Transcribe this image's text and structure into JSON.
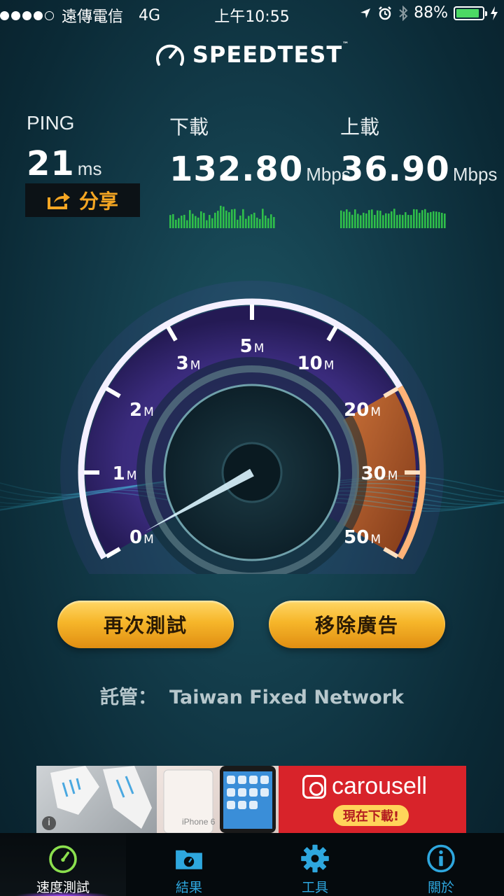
{
  "status_bar": {
    "carrier": "遠傳電信",
    "network": "4G",
    "time": "上午10:55",
    "battery": "88%",
    "signal_bars": 4,
    "battery_level": 0.88
  },
  "app": {
    "title": "SPEEDTEST",
    "trademark": "™"
  },
  "ping": {
    "label": "PING",
    "value": "21",
    "unit": "ms"
  },
  "download": {
    "label": "下載",
    "value": "132.80",
    "unit": "Mbps"
  },
  "upload": {
    "label": "上載",
    "value": "36.90",
    "unit": "Mbps"
  },
  "share_label": "分享",
  "gauge": {
    "ticks": [
      {
        "num": "0",
        "unit": "M"
      },
      {
        "num": "1",
        "unit": "M"
      },
      {
        "num": "2",
        "unit": "M"
      },
      {
        "num": "3",
        "unit": "M"
      },
      {
        "num": "5",
        "unit": "M"
      },
      {
        "num": "10",
        "unit": "M"
      },
      {
        "num": "20",
        "unit": "M"
      },
      {
        "num": "30",
        "unit": "M"
      },
      {
        "num": "50",
        "unit": "M"
      }
    ],
    "needle_value": 0
  },
  "buttons": {
    "retest": "再次測試",
    "remove_ads": "移除廣告"
  },
  "host": {
    "label": "託管：",
    "name": "Taiwan Fixed Network"
  },
  "ad": {
    "brand": "carousell",
    "cta": "現在下載!",
    "phone_label": "iPhone 6"
  },
  "tabs": [
    {
      "label": "速度測試",
      "icon": "speedometer-icon",
      "active": true
    },
    {
      "label": "結果",
      "icon": "folder-icon",
      "active": false
    },
    {
      "label": "工具",
      "icon": "gear-icon",
      "active": false
    },
    {
      "label": "關於",
      "icon": "info-icon",
      "active": false
    }
  ],
  "colors": {
    "accent": "#f5a623",
    "tab_blue": "#2ea7de",
    "active_green": "#8be04e",
    "gauge_purple": "#5b3fa6",
    "gauge_orange": "#e0712a"
  }
}
